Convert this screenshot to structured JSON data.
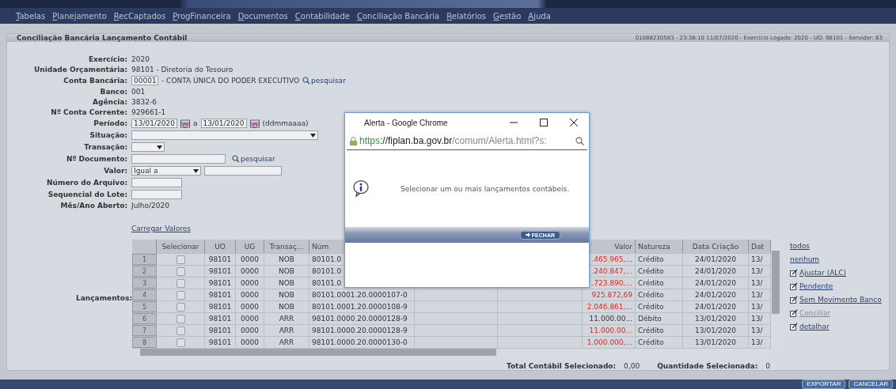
{
  "menu": [
    "Tabelas",
    "Planejamento",
    "RecCaptados",
    "ProgFinanceira",
    "Documentos",
    "Contabilidade",
    "Conciliação Bancária",
    "Relatórios",
    "Gestão",
    "Ajuda"
  ],
  "page_title": "Conciliação Bancária Lançamento Contábil",
  "session_info": "01088230583 - 23:38:10 11/07/2020 - Exercício Logado: 2020 - UO: 98101 - Servidor: 63",
  "form": [
    {
      "kind": "text",
      "label": "Exercício:",
      "value": "2020"
    },
    {
      "kind": "text",
      "label": "Unidade Orçamentária:",
      "value": "98101 - Diretoria do Tesouro"
    },
    {
      "kind": "account",
      "label": "Conta Bancária:",
      "value": "00001",
      "description": "- CONTA ÚNICA DO PODER EXECUTIVO",
      "link": "pesquisar"
    },
    {
      "kind": "text",
      "label": "Banco:",
      "value": "001"
    },
    {
      "kind": "text",
      "label": "Agência:",
      "value": "3832-6"
    },
    {
      "kind": "text",
      "label": "Nº Conta Corrente:",
      "value": "929661-1"
    },
    {
      "kind": "period",
      "label": "Período:",
      "from": "13/01/2020",
      "separator": "a",
      "to": "13/01/2020",
      "hint": "(ddmmaaaa)"
    },
    {
      "kind": "wideselect",
      "label": "Situação:"
    },
    {
      "kind": "select",
      "label": "Transação:"
    },
    {
      "kind": "search",
      "label": "Nº Documento:",
      "link": "pesquisar"
    },
    {
      "kind": "compare",
      "label": "Valor:",
      "option": "Igual a"
    },
    {
      "kind": "input",
      "label": "Número do Arquivo:"
    },
    {
      "kind": "input",
      "label": "Sequencial do Lote:"
    },
    {
      "kind": "text",
      "label": "Mês/Ano Aberto:",
      "value": "Julho/2020"
    }
  ],
  "load_link": "Carregar Valores",
  "table_label": "Lançamentos:",
  "columns": [
    "Selecionar",
    "UO",
    "UG",
    "Transaç...",
    "Núm",
    "Valor",
    "Natureza",
    "Data Criação",
    "Dat"
  ],
  "rows": [
    {
      "n": "1",
      "selected": false,
      "uo": "98101",
      "ug": "0000",
      "transacao": "NOB",
      "numero": "80101.0",
      "valor": ".465.965,...",
      "negative": true,
      "natureza": "Crédito",
      "data_criacao": "24/01/2020",
      "data": "13/"
    },
    {
      "n": "2",
      "selected": false,
      "uo": "98101",
      "ug": "0000",
      "transacao": "NOB",
      "numero": "80101.0",
      "valor": ".240.847,...",
      "negative": true,
      "natureza": "Crédito",
      "data_criacao": "24/01/2020",
      "data": "13/"
    },
    {
      "n": "3",
      "selected": false,
      "uo": "98101",
      "ug": "0000",
      "transacao": "NOB",
      "numero": "80101.0",
      "valor": ".723.890,...",
      "negative": true,
      "natureza": "Crédito",
      "data_criacao": "24/01/2020",
      "data": "13/"
    },
    {
      "n": "4",
      "selected": false,
      "uo": "98101",
      "ug": "0000",
      "transacao": "NOB",
      "numero": "80101.0001.20.0000107-0",
      "valor": "925.872,69",
      "negative": true,
      "natureza": "Crédito",
      "data_criacao": "24/01/2020",
      "data": "13/"
    },
    {
      "n": "5",
      "selected": false,
      "uo": "98101",
      "ug": "0000",
      "transacao": "NOB",
      "numero": "80101.0001.20.0000108-9",
      "valor": "2.046.861,...",
      "negative": true,
      "natureza": "Crédito",
      "data_criacao": "24/01/2020",
      "data": "13/"
    },
    {
      "n": "6",
      "selected": false,
      "uo": "98101",
      "ug": "0000",
      "transacao": "ARR",
      "numero": "98101.0000.20.0000128-9",
      "valor": "11.000.00...",
      "negative": false,
      "natureza": "Débito",
      "data_criacao": "13/01/2020",
      "data": "13/"
    },
    {
      "n": "7",
      "selected": false,
      "uo": "98101",
      "ug": "0000",
      "transacao": "ARR",
      "numero": "98101.0000.20.0000128-9",
      "valor": "11.000.00...",
      "negative": true,
      "natureza": "Crédito",
      "data_criacao": "13/01/2020",
      "data": "13/"
    },
    {
      "n": "8",
      "selected": false,
      "uo": "98101",
      "ug": "0000",
      "transacao": "ARR",
      "numero": "98101.0000.20.0000130-0",
      "valor": "1.000.000,...",
      "negative": true,
      "natureza": "Crédito",
      "data_criacao": "13/01/2020",
      "data": "13/"
    }
  ],
  "actions": [
    {
      "label": "todos",
      "icon": false,
      "disabled": false
    },
    {
      "label": "nenhum",
      "icon": false,
      "disabled": false
    },
    {
      "label": "Ajustar (ALC)",
      "icon": true,
      "disabled": false
    },
    {
      "label": "Pendente",
      "icon": true,
      "disabled": false
    },
    {
      "label": "Sem Movimento Banco",
      "icon": true,
      "disabled": false
    },
    {
      "label": "Conciliar",
      "icon": true,
      "disabled": true
    },
    {
      "label": "detalhar",
      "icon": true,
      "disabled": false
    }
  ],
  "totals": [
    {
      "label": "Total Contábil Selecionado:",
      "value": "0,00"
    },
    {
      "label": "Quantidade Selecionada:",
      "value": "0"
    }
  ],
  "bottom_buttons": [
    "EXPORTAR",
    "CANCELAR"
  ],
  "popup": {
    "title": "Alerta - Google Chrome",
    "url": {
      "scheme": "https",
      "host": "://fiplan.ba.gov.br",
      "path": "/comum/Alerta.html?s:"
    },
    "message": "Selecionar um ou mais lançamentos contábeis.",
    "button": "FECHAR"
  }
}
